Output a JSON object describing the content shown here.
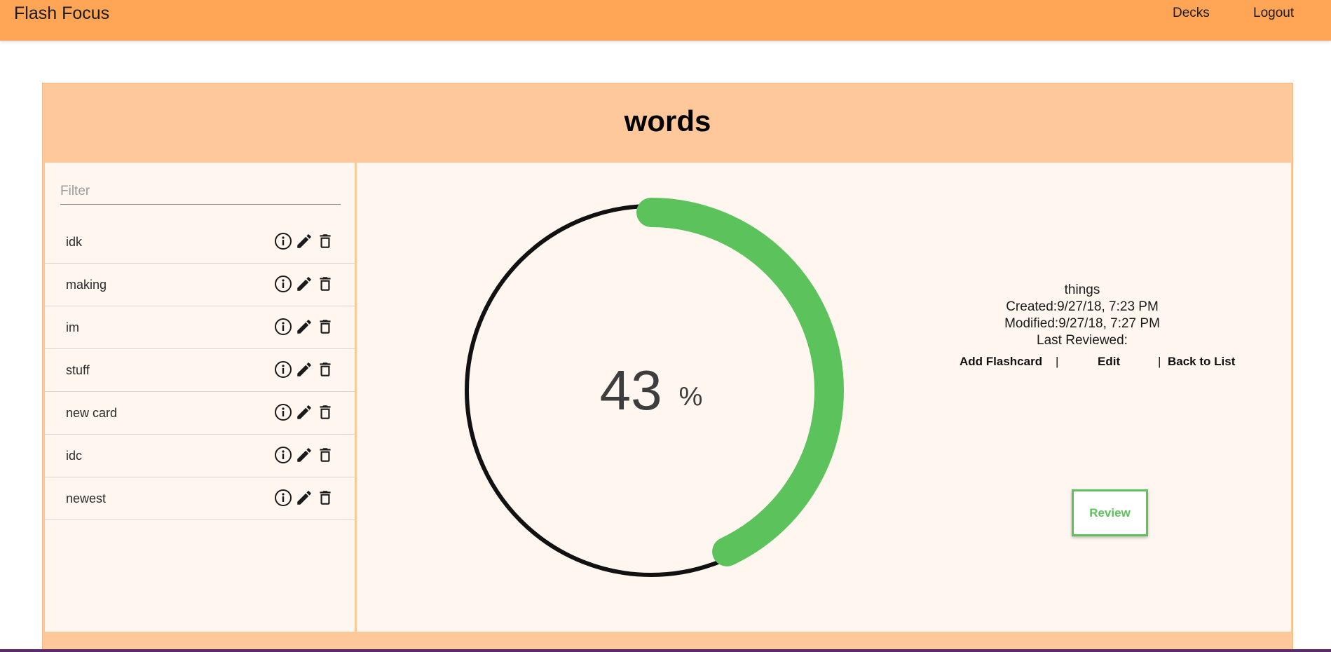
{
  "app": {
    "title": "Flash Focus"
  },
  "nav": {
    "decks": "Decks",
    "logout": "Logout"
  },
  "deck": {
    "title": "words"
  },
  "filter": {
    "placeholder": "Filter"
  },
  "cards": [
    {
      "label": "idk"
    },
    {
      "label": "making"
    },
    {
      "label": "im"
    },
    {
      "label": "stuff"
    },
    {
      "label": "new card"
    },
    {
      "label": "idc"
    },
    {
      "label": "newest"
    }
  ],
  "progress": {
    "value": "43",
    "unit": "%",
    "fraction": 0.43,
    "color": "#5cc25c",
    "track_color": "#111111"
  },
  "details": {
    "name": "things",
    "created": "Created:9/27/18, 7:23 PM",
    "modified": "Modified:9/27/18, 7:27 PM",
    "last_reviewed": "Last Reviewed:"
  },
  "actions": {
    "add": "Add Flashcard",
    "sep": "|",
    "edit": "Edit",
    "back": "Back to List"
  },
  "review": {
    "label": "Review"
  },
  "colors": {
    "header": "#ffa556",
    "card": "#ffc89a",
    "panel": "#fff6f0",
    "accent": "#5cc25c"
  },
  "icons": {
    "info": "info-icon",
    "edit": "pencil-icon",
    "delete": "trash-icon"
  }
}
